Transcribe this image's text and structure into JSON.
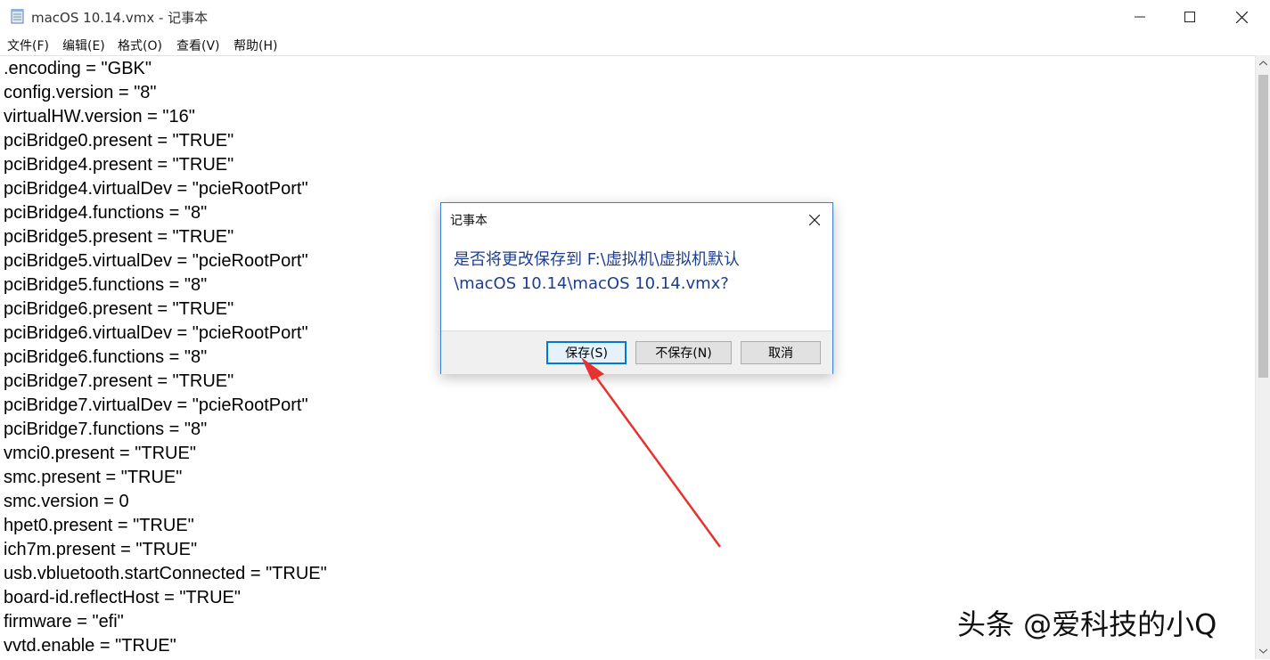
{
  "window": {
    "title": "macOS 10.14.vmx - 记事本",
    "app_icon": "notepad-icon",
    "controls": [
      "minimize-icon",
      "maximize-icon",
      "close-icon"
    ]
  },
  "menu": {
    "items": [
      "文件(F)",
      "编辑(E)",
      "格式(O)",
      "查看(V)",
      "帮助(H)"
    ]
  },
  "editor": {
    "lines": [
      ".encoding = \"GBK\"",
      "config.version = \"8\"",
      "virtualHW.version = \"16\"",
      "pciBridge0.present = \"TRUE\"",
      "pciBridge4.present = \"TRUE\"",
      "pciBridge4.virtualDev = \"pcieRootPort\"",
      "pciBridge4.functions = \"8\"",
      "pciBridge5.present = \"TRUE\"",
      "pciBridge5.virtualDev = \"pcieRootPort\"",
      "pciBridge5.functions = \"8\"",
      "pciBridge6.present = \"TRUE\"",
      "pciBridge6.virtualDev = \"pcieRootPort\"",
      "pciBridge6.functions = \"8\"",
      "pciBridge7.present = \"TRUE\"",
      "pciBridge7.virtualDev = \"pcieRootPort\"",
      "pciBridge7.functions = \"8\"",
      "vmci0.present = \"TRUE\"",
      "smc.present = \"TRUE\"",
      "smc.version = 0",
      "hpet0.present = \"TRUE\"",
      "ich7m.present = \"TRUE\"",
      "usb.vbluetooth.startConnected = \"TRUE\"",
      "board-id.reflectHost = \"TRUE\"",
      "firmware = \"efi\"",
      "vvtd.enable = \"TRUE\""
    ]
  },
  "dialog": {
    "title": "记事本",
    "message_line1": "是否将更改保存到 F:\\虚拟机\\虚拟机默认",
    "message_line2": "\\macOS 10.14\\macOS 10.14.vmx?",
    "save_label": "保存(S)",
    "dont_save_label": "不保存(N)",
    "cancel_label": "取消"
  },
  "annotation": {
    "color": "#e8322f"
  },
  "watermark": "头条 @爱科技的小Q"
}
